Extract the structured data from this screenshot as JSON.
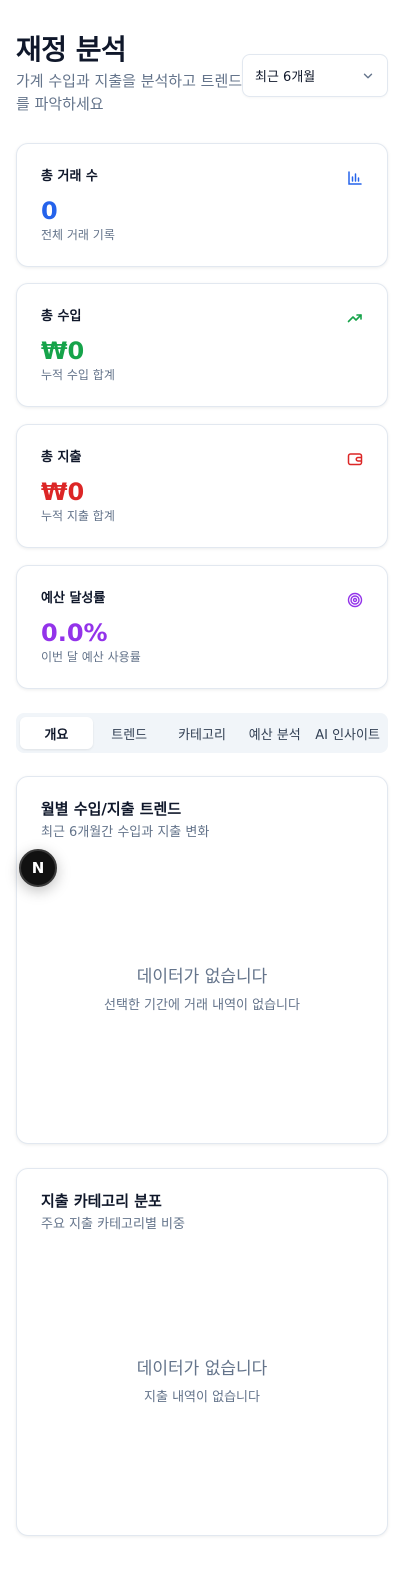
{
  "header": {
    "title": "재정 분석",
    "subtitle": "가계 수입과 지출을 분석하고 트렌드를 파악하세요",
    "period_select": {
      "value": "최근 6개월"
    }
  },
  "stats": [
    {
      "label": "총 거래 수",
      "value": "0",
      "desc": "전체 거래 기록",
      "icon": "bar-chart-icon",
      "color": "#2563eb"
    },
    {
      "label": "총 수입",
      "value": "₩0",
      "desc": "누적 수입 합계",
      "icon": "trending-up-icon",
      "color": "#16a34a"
    },
    {
      "label": "총 지출",
      "value": "₩0",
      "desc": "누적 지출 합계",
      "icon": "wallet-icon",
      "color": "#dc2626"
    },
    {
      "label": "예산 달성률",
      "value": "0.0%",
      "desc": "이번 달 예산 사용률",
      "icon": "target-icon",
      "color": "#9333ea"
    }
  ],
  "tabs": [
    {
      "label": "개요",
      "active": true
    },
    {
      "label": "트렌드"
    },
    {
      "label": "카테고리"
    },
    {
      "label": "예산 분석"
    },
    {
      "label": "AI 인사이트"
    }
  ],
  "charts": [
    {
      "title": "월별 수입/지출 트렌드",
      "subtitle": "최근 6개월간 수입과 지출 변화",
      "empty_title": "데이터가 없습니다",
      "empty_desc": "선택한 기간에 거래 내역이 없습니다"
    },
    {
      "title": "지출 카테고리 분포",
      "subtitle": "주요 지출 카테고리별 비중",
      "empty_title": "데이터가 없습니다",
      "empty_desc": "지출 내역이 없습니다"
    }
  ],
  "float_badge": {
    "letter": "N"
  }
}
